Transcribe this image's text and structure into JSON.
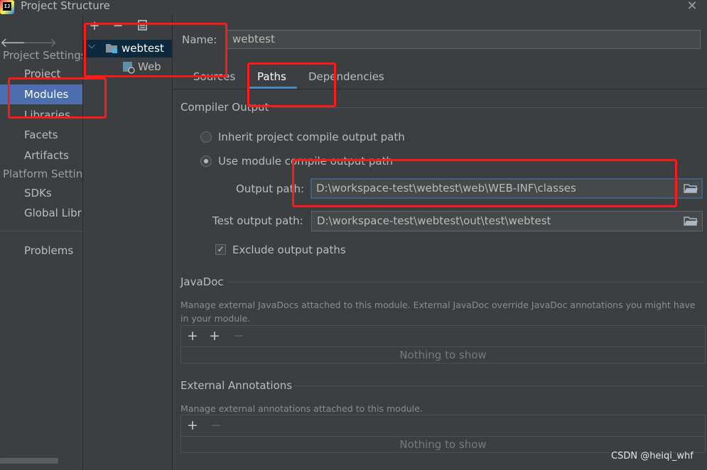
{
  "window": {
    "title": "Project Structure",
    "app_icon_letters": "IJ"
  },
  "nav": {
    "project_settings_header": "Project Settings",
    "platform_settings_header": "Platform Settings",
    "items": [
      {
        "label": "Project"
      },
      {
        "label": "Modules",
        "selected": true
      },
      {
        "label": "Libraries"
      },
      {
        "label": "Facets"
      },
      {
        "label": "Artifacts"
      },
      {
        "label": "SDKs"
      },
      {
        "label": "Global Libraries"
      },
      {
        "label": "Problems"
      }
    ]
  },
  "tree": {
    "toolbar": [
      "add",
      "remove",
      "copy"
    ],
    "module": "webtest",
    "facet": "Web"
  },
  "module": {
    "name_label": "Name:",
    "name_value": "webtest",
    "tabs": [
      {
        "label": "Sources"
      },
      {
        "label": "Paths",
        "selected": true
      },
      {
        "label": "Dependencies"
      }
    ]
  },
  "compiler_output": {
    "title": "Compiler Output",
    "inherit_label": "Inherit project compile output path",
    "use_module_label": "Use module compile output path",
    "selected_option": "use_module",
    "output_path_label": "Output path:",
    "output_path_value": "D:\\workspace-test\\webtest\\web\\WEB-INF\\classes",
    "test_output_path_label": "Test output path:",
    "test_output_path_value": "D:\\workspace-test\\webtest\\out\\test\\webtest",
    "exclude_label": "Exclude output paths",
    "exclude_checked": true
  },
  "javadoc": {
    "title": "JavaDoc",
    "description": "Manage external JavaDocs attached to this module. External JavaDoc override JavaDoc annotations you might have in your module.",
    "empty_text": "Nothing to show"
  },
  "external_annotations": {
    "title": "External Annotations",
    "description": "Manage external annotations attached to this module.",
    "empty_text": "Nothing to show"
  },
  "watermark": "CSDN @heiqi_whf",
  "colors": {
    "background": "#3c3f41",
    "selection": "#4b6eaf",
    "highlight": "#ff1a1a",
    "focus": "#3d6185"
  }
}
